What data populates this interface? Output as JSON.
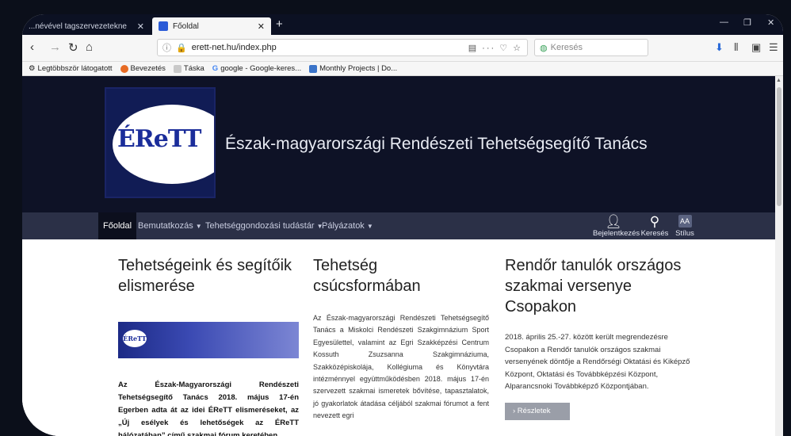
{
  "browser": {
    "tabs": [
      {
        "label": "...névével tagszervezetekne",
        "active": false
      },
      {
        "label": "Főoldal",
        "active": true
      }
    ],
    "url": "erett-net.hu/index.php",
    "search_placeholder": "Keresés",
    "bookmarks": [
      "Legtöbbször látogatott",
      "Bevezetés",
      "Táska",
      "google - Google-keres...",
      "Monthly Projects | Do..."
    ]
  },
  "site": {
    "logo_text": "ÉReTT",
    "title": "Észak-magyarországi Rendészeti Tehetségsegítő Tanács"
  },
  "menu": {
    "items": [
      {
        "label": "Főoldal",
        "caret": ""
      },
      {
        "label": "Bemutatkozás",
        "caret": "▼"
      },
      {
        "label": "Tehetséggondozási tudástár",
        "caret": "▼"
      },
      {
        "label": "Pályázatok",
        "caret": "▼"
      }
    ],
    "tools": [
      {
        "label": "Bejelentkezés",
        "icon": "user-icon"
      },
      {
        "label": "Keresés",
        "icon": "search-icon"
      },
      {
        "label": "Stílus",
        "icon": "text-style-icon"
      }
    ]
  },
  "articles": [
    {
      "title": "Tehetségeink és segítőik elismerése",
      "banner_logo": "ÉReTT",
      "body": "Az Észak-Magyarországi Rendészeti Tehetségsegítő Tanács 2018. május 17-én Egerben adta át az idei ÉReTT elismeréseket, az „Új esélyek és lehetőségek az ÉReTT hálózatában” című szakmai fórum keretében."
    },
    {
      "title": "Tehetség csúcsformában",
      "body": "Az Észak-magyarországi Rendészeti Tehetségsegítő Tanács a Miskolci Rendészeti Szakgimnázium Sport Egyesülettel, valamint az Egri Szakképzési Centrum Kossuth Zsuzsanna Szakgimnáziuma, Szakközépiskolája, Kollégiuma és Könyvtára intézménnyel együttműködésben 2018. május 17-én szervezett szakmai ismeretek bővítése, tapasztalatok, jó gyakorlatok átadása céljából szakmai fórumot a fent nevezett egri"
    },
    {
      "title": "Rendőr tanulók országos szakmai versenye Csopakon",
      "body": "2018. április 25.-27. között került megrendezésre Csopakon a Rendőr tanulók országos szakmai versenyének döntője a Rendőrségi Oktatási és Kiképző Központ, Oktatási és Továbbképzési Központ, Alparancsnoki Továbbképző Központjában.",
      "button_label": "› Részletek"
    }
  ],
  "colors": {
    "header_bg": "#0e1226",
    "menu_bg": "#2b3047",
    "logo_blue": "#1b2d9a"
  }
}
